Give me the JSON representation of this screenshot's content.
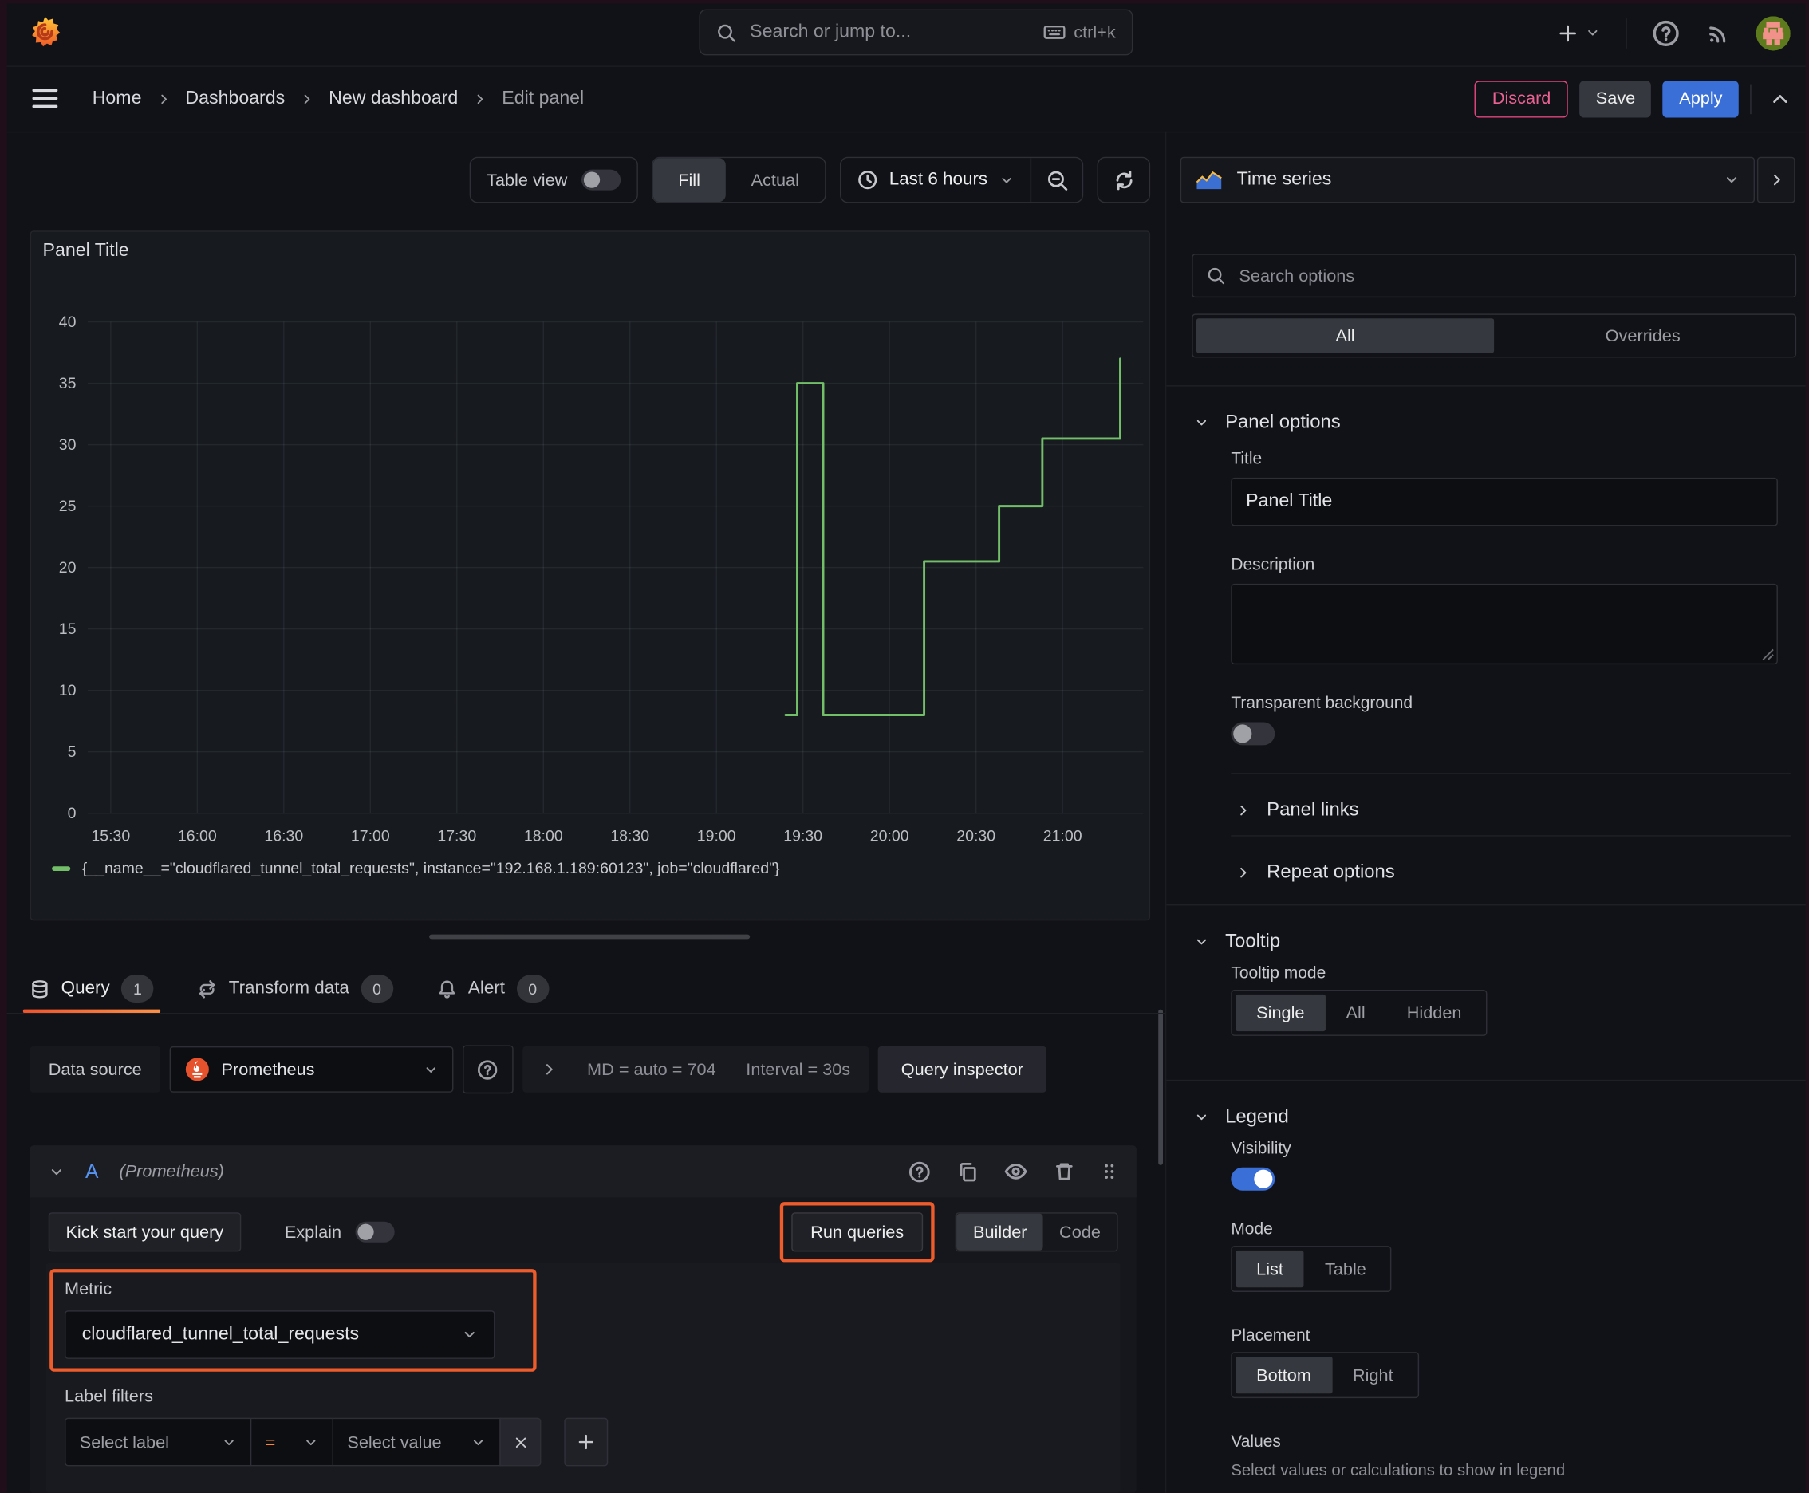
{
  "colors": {
    "green": "#73bf69",
    "blue": "#3a6fd8",
    "orange": "#ee5c2c",
    "pink": "#e0457b"
  },
  "topnav": {
    "search_placeholder": "Search or jump to...",
    "shortcut": "ctrl+k"
  },
  "breadcrumb": {
    "items": [
      "Home",
      "Dashboards",
      "New dashboard",
      "Edit panel"
    ],
    "discard": "Discard",
    "save": "Save",
    "apply": "Apply"
  },
  "toolbar": {
    "table_view": "Table view",
    "fill": "Fill",
    "actual": "Actual",
    "time_range": "Last 6 hours"
  },
  "panel": {
    "title": "Panel Title"
  },
  "chart_data": {
    "type": "line",
    "interpolation": "step-after",
    "title": "Panel Title",
    "grid": true,
    "legend_position": "bottom",
    "x_ticks": [
      "15:30",
      "16:00",
      "16:30",
      "17:00",
      "17:30",
      "18:00",
      "18:30",
      "19:00",
      "19:30",
      "20:00",
      "20:30",
      "21:00"
    ],
    "x_range": [
      "15:22",
      "21:28"
    ],
    "y_ticks": [
      0,
      5,
      10,
      15,
      20,
      25,
      30,
      35,
      40
    ],
    "ylim": [
      0,
      40
    ],
    "series": [
      {
        "name": "{__name__=\"cloudflared_tunnel_total_requests\", instance=\"192.168.1.189:60123\", job=\"cloudflared\"}",
        "color": "#73bf69",
        "points": [
          {
            "t": "19:24",
            "v": 8
          },
          {
            "t": "19:28",
            "v": 35
          },
          {
            "t": "19:37",
            "v": 8
          },
          {
            "t": "20:12",
            "v": 20.5
          },
          {
            "t": "20:38",
            "v": 25
          },
          {
            "t": "20:53",
            "v": 30.5
          },
          {
            "t": "21:20",
            "v": 37
          }
        ]
      }
    ]
  },
  "query": {
    "tabs": [
      {
        "label": "Query",
        "count": "1"
      },
      {
        "label": "Transform data",
        "count": "0"
      },
      {
        "label": "Alert",
        "count": "0"
      }
    ],
    "datasource_label": "Data source",
    "datasource": "Prometheus",
    "stats_md": "MD = auto = 704",
    "stats_interval": "Interval = 30s",
    "inspector": "Query inspector",
    "ref_id": "A",
    "ref_source": "(Prometheus)",
    "kickstart": "Kick start your query",
    "explain": "Explain",
    "run": "Run queries",
    "builder": "Builder",
    "code": "Code",
    "metric_label": "Metric",
    "metric_value": "cloudflared_tunnel_total_requests",
    "label_filters": "Label filters",
    "select_label": "Select label",
    "operator": "=",
    "select_value": "Select value"
  },
  "options": {
    "visualization": "Time series",
    "search_placeholder": "Search options",
    "tab_all": "All",
    "tab_overrides": "Overrides",
    "panel_options": "Panel options",
    "title_label": "Title",
    "title_value": "Panel Title",
    "description_label": "Description",
    "transparent_bg": "Transparent background",
    "panel_links": "Panel links",
    "repeat_options": "Repeat options",
    "tooltip": "Tooltip",
    "tooltip_mode": "Tooltip mode",
    "tooltip_single": "Single",
    "tooltip_all": "All",
    "tooltip_hidden": "Hidden",
    "legend": "Legend",
    "visibility": "Visibility",
    "mode": "Mode",
    "mode_list": "List",
    "mode_table": "Table",
    "placement": "Placement",
    "placement_bottom": "Bottom",
    "placement_right": "Right",
    "values_label": "Values",
    "values_help": "Select values or calculations to show in legend"
  }
}
